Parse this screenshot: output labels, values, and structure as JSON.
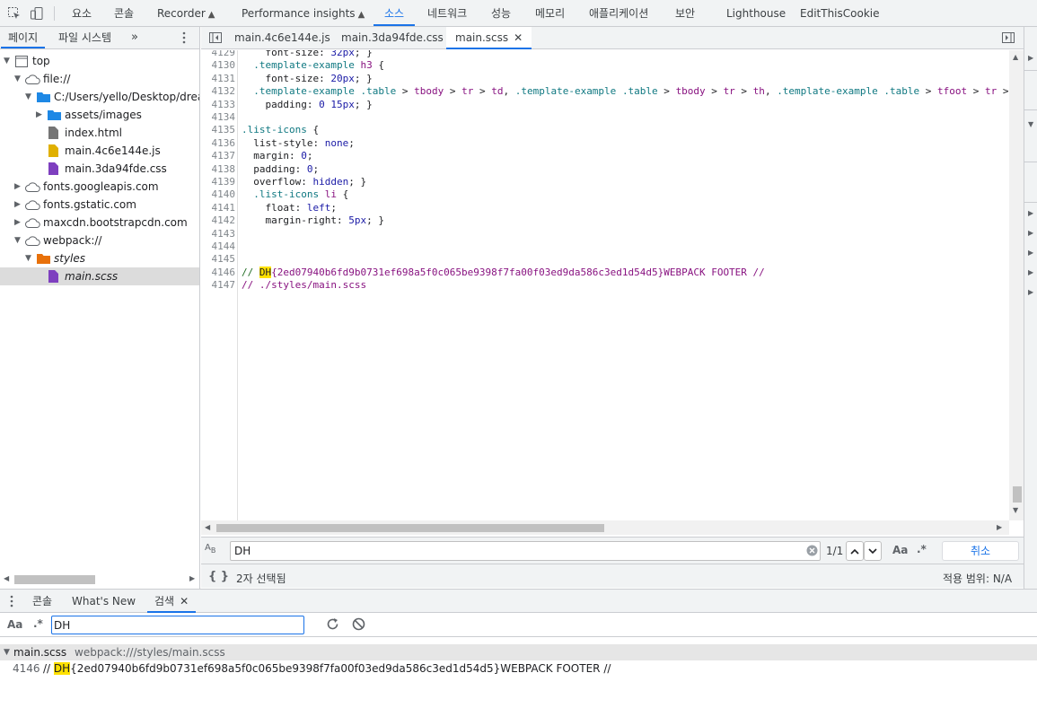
{
  "toolbar": {
    "tabs": [
      "요소",
      "콘솔",
      "Recorder",
      "Performance insights",
      "소스",
      "네트워크",
      "성능",
      "메모리",
      "애플리케이션",
      "보안",
      "Lighthouse",
      "EditThisCookie"
    ],
    "active_tab": "소스",
    "icons": [
      "inspect-element-icon",
      "device-toolbar-icon"
    ]
  },
  "navigator": {
    "tabs": [
      "페이지",
      "파일 시스템"
    ],
    "more": "»",
    "tree": [
      {
        "label": "top",
        "icon": "frame-icon"
      },
      {
        "label": "file://",
        "icon": "cloud-icon"
      },
      {
        "label": "C:/Users/yello/Desktop/dreamh",
        "icon": "folder-icon"
      },
      {
        "label": "assets/images",
        "icon": "folder-icon"
      },
      {
        "label": "index.html",
        "icon": "file-icon"
      },
      {
        "label": "main.4c6e144e.js",
        "icon": "js-file-icon"
      },
      {
        "label": "main.3da94fde.css",
        "icon": "css-file-icon"
      },
      {
        "label": "fonts.googleapis.com",
        "icon": "cloud-icon"
      },
      {
        "label": "fonts.gstatic.com",
        "icon": "cloud-icon"
      },
      {
        "label": "maxcdn.bootstrapcdn.com",
        "icon": "cloud-icon"
      },
      {
        "label": "webpack://",
        "icon": "cloud-icon"
      },
      {
        "label": "styles",
        "icon": "folder-icon"
      },
      {
        "label": "main.scss",
        "icon": "css-file-icon"
      }
    ]
  },
  "editor": {
    "tabs": [
      "main.4c6e144e.js",
      "main.3da94fde.css",
      "main.scss"
    ],
    "active_tab": "main.scss",
    "lines": [
      {
        "n": "4129",
        "text": "    font-size: 32px; }"
      },
      {
        "n": "4130",
        "text": "  .template-example h3 {"
      },
      {
        "n": "4131",
        "text": "    font-size: 20px; }"
      },
      {
        "n": "4132",
        "text": "  .template-example .table > tbody > tr > td, .template-example .table > tbody > tr > th, .template-example .table > tfoot > tr >"
      },
      {
        "n": "4133",
        "text": "    padding: 0 15px; }"
      },
      {
        "n": "4134",
        "text": ""
      },
      {
        "n": "4135",
        "text": ".list-icons {"
      },
      {
        "n": "4136",
        "text": "  list-style: none;"
      },
      {
        "n": "4137",
        "text": "  margin: 0;"
      },
      {
        "n": "4138",
        "text": "  padding: 0;"
      },
      {
        "n": "4139",
        "text": "  overflow: hidden; }"
      },
      {
        "n": "4140",
        "text": "  .list-icons li {"
      },
      {
        "n": "4141",
        "text": "    float: left;"
      },
      {
        "n": "4142",
        "text": "    margin-right: 5px; }"
      },
      {
        "n": "4143",
        "text": ""
      },
      {
        "n": "4144",
        "text": ""
      },
      {
        "n": "4145",
        "text": ""
      },
      {
        "n": "4146",
        "text": "// DH{2ed07940b6fd9b0731ef698a5f0c065be9398f7fa00f03ed9da586c3ed1d54d5}WEBPACK FOOTER //"
      },
      {
        "n": "4147",
        "text": "// ./styles/main.scss"
      }
    ]
  },
  "search": {
    "query": "DH",
    "match_count": "1/1",
    "case_label": "Aa",
    "regex_label": ".*",
    "cancel_label": "취소"
  },
  "status": {
    "pretty_print": "{ }",
    "selection": "2자 선택됨",
    "coverage": "적용 범위: N/A"
  },
  "drawer": {
    "tabs": [
      "콘솔",
      "What's New",
      "검색"
    ],
    "active_tab": "검색",
    "search_query": "DH",
    "result_file": "main.scss",
    "result_path": "webpack:///styles/main.scss",
    "result_line_no": "4146",
    "result_prefix": "// ",
    "result_match": "DH",
    "result_suffix": "{2ed07940b6fd9b0731ef698a5f0c065be9398f7fa00f03ed9da586c3ed1d54d5}WEBPACK FOOTER //"
  },
  "colors": {
    "accent": "#1a73e8",
    "highlight": "#ffe100",
    "selector": "#0f7881",
    "value": "#1a1aa6"
  }
}
